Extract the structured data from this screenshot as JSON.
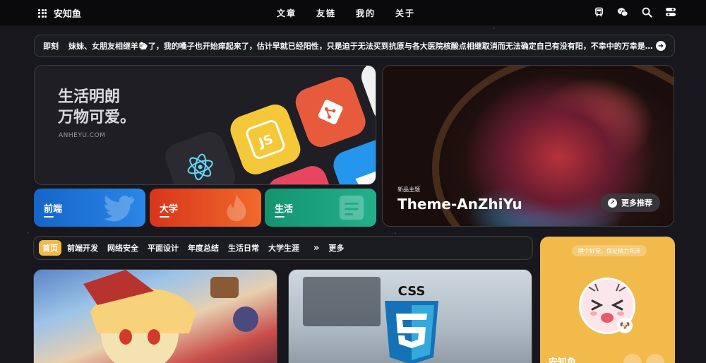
{
  "nav": {
    "site_name": "安知鱼",
    "menu": [
      "文章",
      "友链",
      "我的",
      "关于"
    ],
    "icons": [
      "train-icon",
      "wechat-icon",
      "search-icon",
      "toggle-icon"
    ]
  },
  "ticker": {
    "tag": "即刻",
    "text": "妹妹、女朋友相继羊🐑了，我的嗓子也开始痒起来了，估计早就已经阳性，只是迫于无法买到抗原与各大医院核酸点相继取消而无法确定自己有没有阳，不幸中的万幸是症状都..."
  },
  "hero_left": {
    "title_line1": "生活明朗",
    "title_line2": "万物可爱。",
    "subtitle": "ANHEYU.COM"
  },
  "categories": [
    {
      "label": "前端",
      "color": "#1b6fd2"
    },
    {
      "label": "大学",
      "color": "#e2461e"
    },
    {
      "label": "生活",
      "color": "#1a9c7a"
    }
  ],
  "hero_right": {
    "tag": "新品主题",
    "title": "Theme-AnZhiYu",
    "button": "更多推荐"
  },
  "category_bar": {
    "items": [
      "首页",
      "前端开发",
      "网络安全",
      "平面设计",
      "年度总结",
      "生活日常",
      "大学生涯"
    ],
    "more": "更多"
  },
  "posts": [
    {
      "cover": "anime-illustration"
    },
    {
      "cover": "css3-logo",
      "logo_text": "CSS"
    }
  ],
  "sidebar": {
    "pill": "睡个好觉，保证精力充沛",
    "name": "安知鱼"
  },
  "colors": {
    "background": "#18171d",
    "accent": "#f2b94b"
  }
}
